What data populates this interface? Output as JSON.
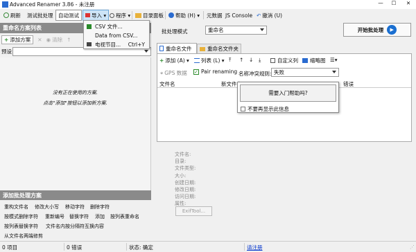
{
  "window": {
    "title": "Advanced Renamer 3.86 - 未注册"
  },
  "toolbar": {
    "refresh": "刷新",
    "test_batch": "测试批处理",
    "auto_test": "自动测试",
    "import": "导入",
    "program": "程序",
    "dir_panel": "目录面板",
    "help": "帮助 (H)",
    "metadata": "元数据",
    "js_console": "JS Console",
    "undo": "撤消 (U)"
  },
  "import_menu": {
    "items": [
      {
        "label": "CSV 文件...",
        "shortcut": ""
      },
      {
        "label": "Data from CSV...",
        "shortcut": ""
      },
      {
        "label": "电视节目...",
        "shortcut": "Ctrl+Y"
      }
    ]
  },
  "left_panel": {
    "header": "重命名方案列表",
    "add_method": "添加方案",
    "clear": "清除",
    "preset_label": "预设:",
    "empty_line1": "没有正在使用的方案.",
    "empty_line2": "点击\"添加\"按钮以添加新方案."
  },
  "add_panel": {
    "header": "添加批处理方案",
    "methods": [
      "重构文件名",
      "修改大小写",
      "移动字符",
      "删除字符",
      "按模式删除字符",
      "重新编号",
      "替换字符",
      "添加",
      "按列表重命名",
      "按列表替换字符",
      "文件名内按分隔符互换内容",
      "从文件名两端修剪"
    ]
  },
  "right_panel": {
    "batch_mode_label": "批处理模式",
    "batch_mode_value": "重命名",
    "start_button": "开始批处理",
    "tab_files": "重命名文件",
    "tab_folders": "重命名文件夹",
    "add": "添加 (A)",
    "list": "列表 (L)",
    "custom_cols": "自定义列",
    "thumbnail": "缩略图",
    "gps_data": "GPS 数据",
    "pair_renaming": "Pair renaming",
    "conflict_label": "名称冲突规则:",
    "conflict_value": "失败",
    "col_filename": "文件名",
    "col_newname": "新文件名",
    "col_error": "错误",
    "help_button": "需要入门帮助吗?",
    "dont_show": "不要再显示此信息",
    "info_labels": [
      "文件名:",
      "目录:",
      "文件类型:",
      "大小:",
      "创建日期:",
      "修改日期:",
      "访问日期:",
      "属性:"
    ],
    "exiftool": "ExifTool..."
  },
  "status_bar": {
    "items": "0 项目",
    "errors": "0 错误",
    "state": "状态: 确定",
    "register": "请注册"
  },
  "colors": {
    "accent": "#1a6fd1",
    "header_grey": "#8a8a8a",
    "link": "#0033cc"
  }
}
